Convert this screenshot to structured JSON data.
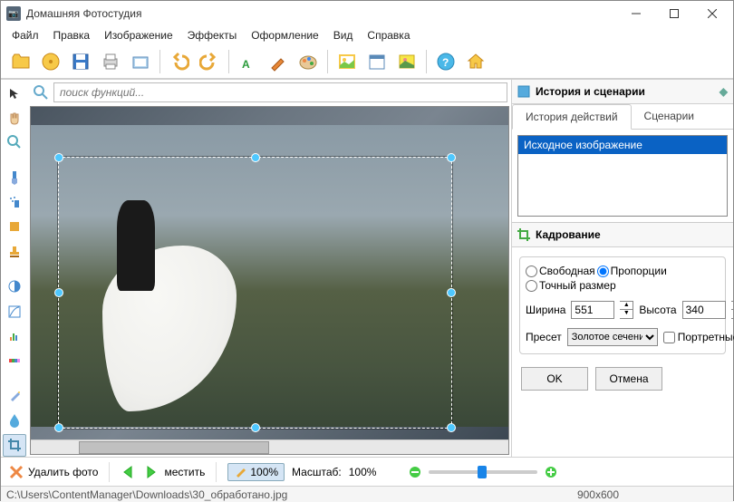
{
  "title": "Домашняя Фотостудия",
  "menu": [
    "Файл",
    "Правка",
    "Изображение",
    "Эффекты",
    "Оформление",
    "Вид",
    "Справка"
  ],
  "search": {
    "placeholder": "поиск функций..."
  },
  "rightpanel": {
    "history_title": "История и сценарии",
    "tab_history": "История действий",
    "tab_scenarios": "Сценарии",
    "history_item": "Исходное изображение",
    "crop_title": "Кадрование",
    "r_free": "Свободная",
    "r_prop": "Пропорции",
    "r_exact": "Точный размер",
    "width_lbl": "Ширина",
    "width_val": "551",
    "height_lbl": "Высота",
    "height_val": "340",
    "preset_lbl": "Пресет",
    "preset_val": "Золотое сечение",
    "portrait_lbl": "Портретные",
    "btn_ok": "OK",
    "btn_cancel": "Отмена"
  },
  "bottom": {
    "delete_label": "Удалить фото",
    "move_label": "местить",
    "fit_label": "100%",
    "scale_label": "Масштаб:",
    "scale_value": "100%"
  },
  "status": {
    "path": "C:\\Users\\ContentManager\\Downloads\\30_обработано.jpg",
    "dims": "900x600"
  }
}
